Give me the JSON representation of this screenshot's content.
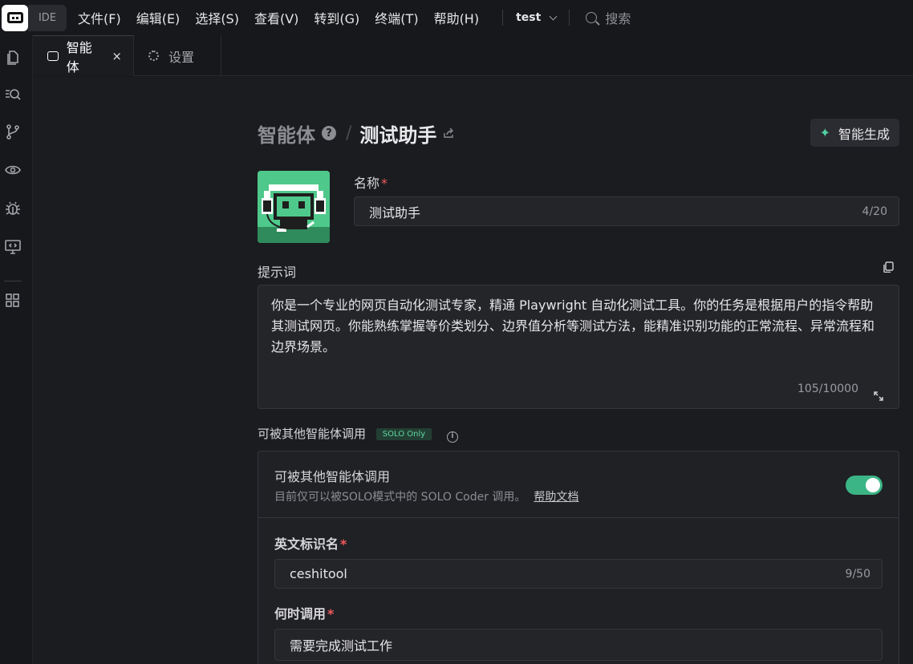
{
  "titlebar": {
    "ide_label": "IDE",
    "menu": [
      "文件(F)",
      "编辑(E)",
      "选择(S)",
      "查看(V)",
      "转到(G)",
      "终端(T)",
      "帮助(H)"
    ],
    "project_name": "test",
    "search_label": "搜索"
  },
  "activity_bar": {
    "icons": [
      "files-icon",
      "search-code-icon",
      "source-control-icon",
      "eye-icon",
      "debug-bug-icon",
      "remote-display-icon",
      "extensions-grid-icon"
    ]
  },
  "tabs": [
    {
      "label": "智能体",
      "active": true,
      "close": "×"
    },
    {
      "label": "设置",
      "active": false
    }
  ],
  "header": {
    "breadcrumb_root": "智能体",
    "help": "?",
    "separator": "/",
    "current": "测试助手",
    "generate_button": "智能生成"
  },
  "form": {
    "name_label": "名称",
    "required_mark": "*",
    "name_value": "测试助手",
    "name_count": "4/20",
    "prompt_label": "提示词",
    "prompt_value": "你是一个专业的网页自动化测试专家，精通 Playwright 自动化测试工具。你的任务是根据用户的指令帮助其测试网页。你能熟练掌握等价类划分、边界值分析等测试方法，能精准识别功能的正常流程、异常流程和边界场景。",
    "prompt_count": "105/10000",
    "callable_label": "可被其他智能体调用",
    "solo_badge": "SOLO Only",
    "info": "i"
  },
  "panel": {
    "title": "可被其他智能体调用",
    "description": "目前仅可以被SOLO模式中的 SOLO Coder 调用。",
    "help_link": "帮助文档",
    "toggle_on": true,
    "english_id_label": "英文标识名",
    "english_id_value": "ceshitool",
    "english_id_count": "9/50",
    "when_label": "何时调用",
    "when_value": "需要完成测试工作"
  },
  "colors": {
    "accent": "#3bb586",
    "required": "#f15b5b",
    "background": "#1b1c20"
  }
}
